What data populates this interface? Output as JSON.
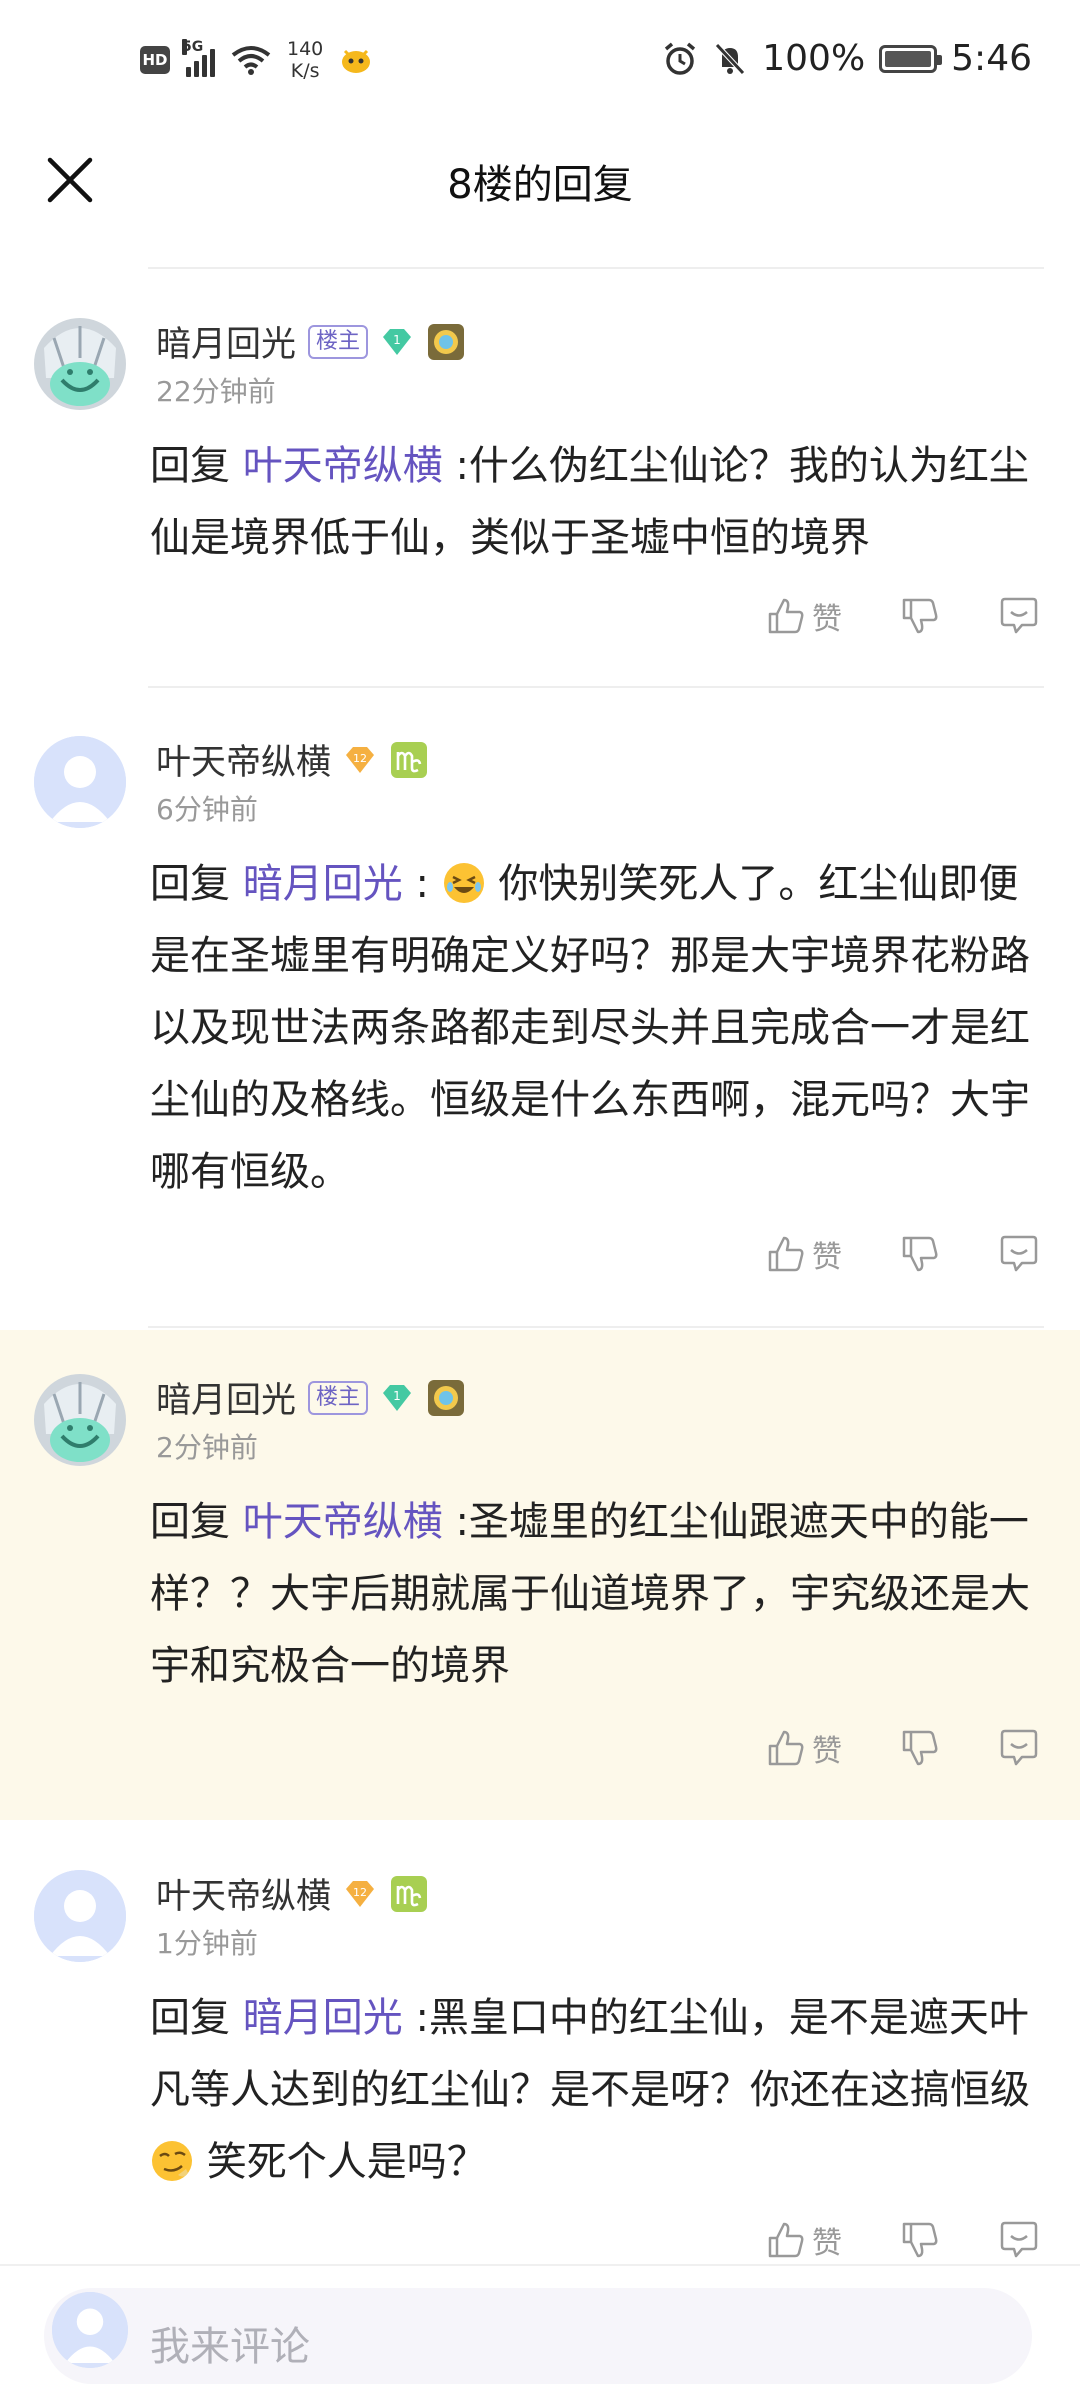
{
  "status_bar": {
    "hd": "HD",
    "network": "5G",
    "speed_value": "140",
    "speed_unit": "K/s",
    "battery_pct": "100%",
    "time": "5:46"
  },
  "header": {
    "title": "8楼的回复"
  },
  "comments": [
    {
      "author": "暗月回光",
      "owner_tag": "楼主",
      "time": "22分钟前",
      "reply_prefix": "回复",
      "reply_to": "叶天帝纵横",
      "text": ":什么伪红尘仙论？我的认为红尘仙是境界低于仙，类似于圣墟中恒的境界",
      "like_label": "赞"
    },
    {
      "author": "叶天帝纵横",
      "time": "6分钟前",
      "reply_prefix": "回复",
      "reply_to": "暗月回光",
      "text_before": ":",
      "text": "你快别笑死人了。红尘仙即便是在圣墟里有明确定义好吗？那是大宇境界花粉路以及现世法两条路都走到尽头并且完成合一才是红尘仙的及格线。恒级是什么东西啊，混元吗？大宇哪有恒级。",
      "like_label": "赞"
    },
    {
      "author": "暗月回光",
      "owner_tag": "楼主",
      "time": "2分钟前",
      "reply_prefix": "回复",
      "reply_to": "叶天帝纵横",
      "text": ":圣墟里的红尘仙跟遮天中的能一样？？大宇后期就属于仙道境界了，宇究级还是大宇和究极合一的境界",
      "like_label": "赞"
    },
    {
      "author": "叶天帝纵横",
      "time": "1分钟前",
      "reply_prefix": "回复",
      "reply_to": "暗月回光",
      "text": ":黑皇口中的红尘仙，是不是遮天叶凡等人达到的红尘仙？是不是呀？你还在这搞恒级",
      "text_after": "笑死个人是吗？",
      "like_label": "赞"
    }
  ],
  "bottom_bar": {
    "placeholder": "我来评论"
  },
  "colors": {
    "link": "#6554c0",
    "highlight_bg": "#fdf9ea",
    "muted": "#999999"
  }
}
